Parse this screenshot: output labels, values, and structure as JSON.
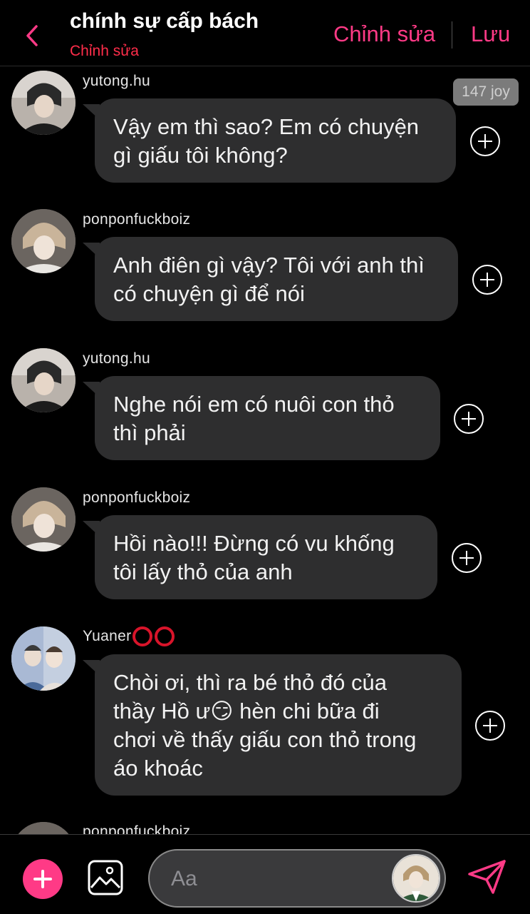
{
  "header": {
    "title": "chính sự cấp bách",
    "subtitle": "Chỉnh sửa",
    "edit_label": "Chỉnh sửa",
    "save_label": "Lưu",
    "accent_color": "#ff3a86"
  },
  "joy_badge": "147 joy",
  "messages": [
    {
      "username": "yutong.hu",
      "lines": [
        "Vậy em thì sao? Em có chuyện",
        "gì giấu tôi không?"
      ]
    },
    {
      "username": "ponponfuckboiz",
      "lines": [
        "Anh điên gì vậy? Tôi với anh thì",
        "có chuyện gì để nói"
      ]
    },
    {
      "username": "yutong.hu",
      "lines": [
        "Nghe nói em có nuôi con thỏ",
        "thì phải"
      ]
    },
    {
      "username": "ponponfuckboiz",
      "lines": [
        "Hồi nào!!! Đừng có vu khống",
        "tôi lấy thỏ của anh"
      ]
    },
    {
      "username": "Yuaner",
      "username_decoration": "⭕⭕",
      "lines": [
        "Chòi ơi, thì ra bé thỏ đó của",
        "thầy Hồ ư😏 hèn chi bữa đi",
        "chơi về thấy giấu con thỏ trong",
        "áo khoác"
      ]
    },
    {
      "username": "ponponfuckboiz",
      "lines": []
    }
  ],
  "composer": {
    "placeholder": "Aa"
  },
  "icons": {
    "back": "chevron-left-icon",
    "add": "plus-icon",
    "gallery": "image-icon",
    "send": "paper-plane-icon",
    "reaction": "plus-circle-icon"
  }
}
